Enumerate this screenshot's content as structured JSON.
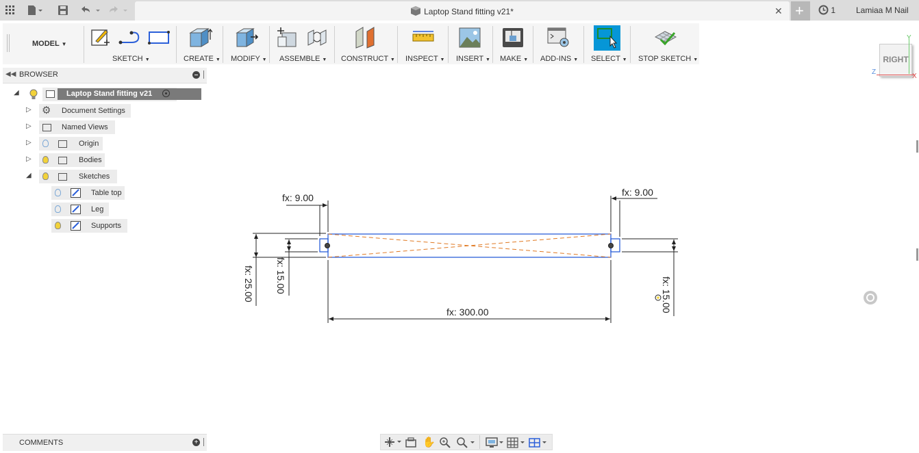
{
  "titlebar": {
    "document_title": "Laptop Stand fitting v21*",
    "job_count": "1",
    "user_name": "Lamiaa M Nail"
  },
  "toolbar": {
    "workspace": "MODEL",
    "groups": [
      "SKETCH",
      "CREATE",
      "MODIFY",
      "ASSEMBLE",
      "CONSTRUCT",
      "INSPECT",
      "INSERT",
      "MAKE",
      "ADD-INS",
      "SELECT",
      "STOP SKETCH"
    ]
  },
  "browser": {
    "title": "BROWSER",
    "root": "Laptop Stand fitting v21",
    "items": [
      "Document Settings",
      "Named Views",
      "Origin",
      "Bodies",
      "Sketches"
    ],
    "sketches": [
      "Table top",
      "Leg",
      "Supports"
    ]
  },
  "viewcube": {
    "face": "RIGHT",
    "axis_y": "Y",
    "axis_z": "Z",
    "axis_x": "X"
  },
  "dimensions": {
    "left_width": "fx: 9.00",
    "right_width": "fx: 9.00",
    "left_height_outer": "fx: 25.00",
    "left_height_inner": "fx: 15.00",
    "right_height": "fx: 15.00",
    "length": "fx: 300.00"
  },
  "comments": {
    "title": "COMMENTS"
  },
  "colors": {
    "accent_select": "#0696d7",
    "sketch_line": "#2b5fd9",
    "construction_line": "#e07820"
  }
}
